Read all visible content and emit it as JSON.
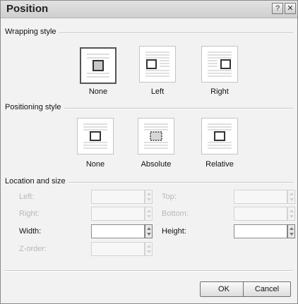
{
  "window": {
    "title": "Position",
    "help_glyph": "?",
    "close_glyph": "✕"
  },
  "wrapping": {
    "heading": "Wrapping style",
    "options": [
      {
        "label": "None",
        "selected": true
      },
      {
        "label": "Left",
        "selected": false
      },
      {
        "label": "Right",
        "selected": false
      }
    ]
  },
  "positioning": {
    "heading": "Positioning style",
    "options": [
      {
        "label": "None",
        "selected": false
      },
      {
        "label": "Absolute",
        "selected": false
      },
      {
        "label": "Relative",
        "selected": false
      }
    ]
  },
  "location": {
    "heading": "Location and size",
    "left_label": "Left:",
    "top_label": "Top:",
    "right_label": "Right:",
    "bottom_label": "Bottom:",
    "width_label": "Width:",
    "height_label": "Height:",
    "zorder_label": "Z-order:",
    "left_value": "",
    "top_value": "",
    "right_value": "",
    "bottom_value": "",
    "width_value": "",
    "height_value": "",
    "zorder_value": ""
  },
  "buttons": {
    "ok": "OK",
    "cancel": "Cancel"
  },
  "colors": {
    "selected_border": "#555555",
    "dialog_bg": "#f2f2f2"
  }
}
